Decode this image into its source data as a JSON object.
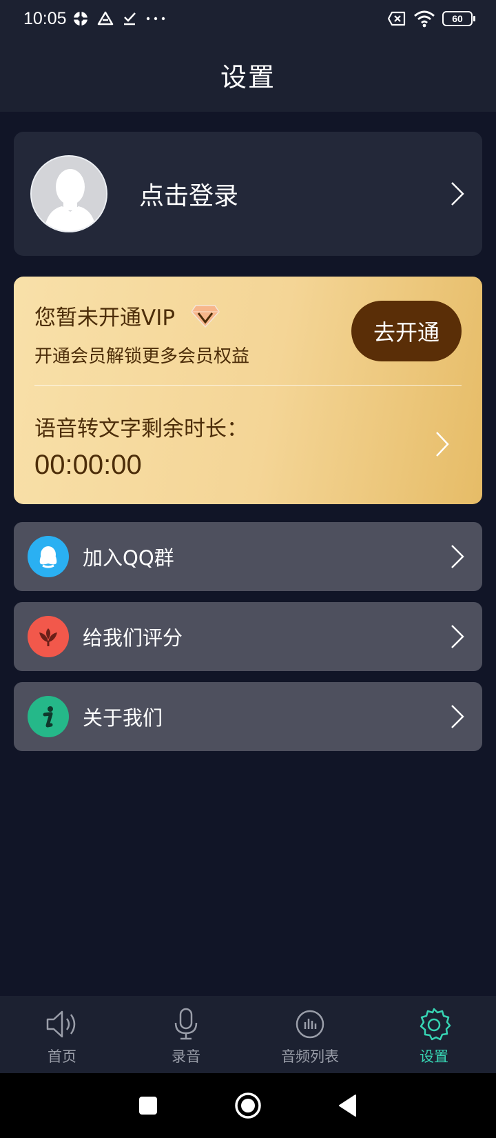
{
  "status_bar": {
    "time": "10:05",
    "battery": "60",
    "left_icons": [
      "app-notification-icon",
      "drive-icon",
      "download-done-icon",
      "more-dots-icon"
    ],
    "right_icons": [
      "sim-off-icon",
      "wifi-icon",
      "battery-icon"
    ]
  },
  "header": {
    "title": "设置"
  },
  "login": {
    "label": "点击登录"
  },
  "vip": {
    "title": "您暂未开通VIP",
    "subtitle": "开通会员解锁更多会员权益",
    "button_label": "去开通",
    "remaining_label": "语音转文字剩余时长：",
    "remaining_value": "00:00:00"
  },
  "menu": {
    "items": [
      {
        "label": "加入QQ群",
        "icon": "qq-icon",
        "icon_color": "#2ab0f2"
      },
      {
        "label": "给我们评分",
        "icon": "flower-icon",
        "icon_color": "#f2584b"
      },
      {
        "label": "关于我们",
        "icon": "info-icon",
        "icon_color": "#25b889"
      }
    ]
  },
  "bottom_nav": {
    "items": [
      {
        "label": "首页",
        "icon": "speaker-icon"
      },
      {
        "label": "录音",
        "icon": "microphone-icon"
      },
      {
        "label": "音频列表",
        "icon": "audio-list-icon"
      },
      {
        "label": "设置",
        "icon": "settings-icon",
        "active": true
      }
    ],
    "active_color": "#37d4b3",
    "inactive_color": "#9a9ea9"
  },
  "colors": {
    "background": "#111527",
    "header": "#1c2131",
    "card": "#232839",
    "menu_item": "#4e505e",
    "vip_button": "#5a2e07",
    "vip_text": "#4c2d09"
  }
}
